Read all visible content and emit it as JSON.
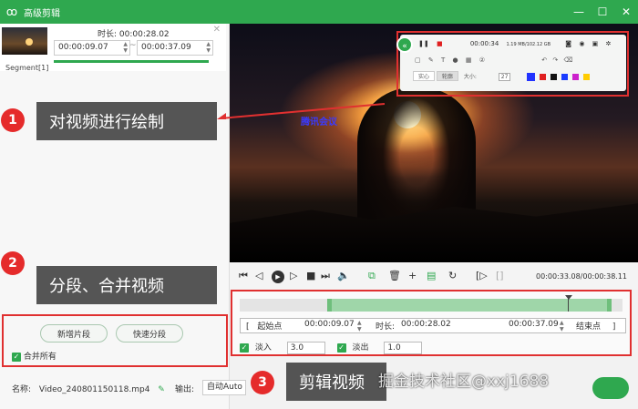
{
  "window": {
    "title": "高级剪辑",
    "minimize": "—",
    "maximize": "☐",
    "close": "✕"
  },
  "segment": {
    "label": "Segment[1]",
    "duration_label": "时长:",
    "duration": "00:00:28.02",
    "start": "00:00:09.07",
    "end": "00:00:37.09",
    "separator": "~"
  },
  "left_buttons": {
    "new_segment": "新增片段",
    "quick_split": "快速分段",
    "merge_all": "合并所有"
  },
  "footer": {
    "name_label": "名称:",
    "file_name": "Video_240801150118.mp4",
    "output_label": "输出:",
    "output_value": "自动Auto"
  },
  "video": {
    "overlay_text": "腾讯会议"
  },
  "recorder": {
    "time": "00:00:34",
    "info": "1.19 MB/102.12 GB",
    "style_a": "实心",
    "style_b": "轮廓",
    "size_label": "大小:",
    "size_value": "27",
    "colors": [
      "#2233ff",
      "#e02020",
      "#111111",
      "#1a3cff",
      "#cc22cc",
      "#ffcc00",
      "#ffffff"
    ]
  },
  "playback": {
    "timecode": "00:00:33.08/00:00:38.11"
  },
  "trim": {
    "start_label": "起始点",
    "start": "00:00:09.07",
    "duration_label": "时长:",
    "duration": "00:00:28.02",
    "end": "00:00:37.09",
    "end_label": "结束点",
    "fade_in_label": "淡入",
    "fade_in": "3.0",
    "fade_out_label": "淡出",
    "fade_out": "1.0"
  },
  "annotations": [
    {
      "num": "1",
      "text": "对视频进行绘制"
    },
    {
      "num": "2",
      "text": "分段、合并视频"
    },
    {
      "num": "3",
      "text": "剪辑视频"
    }
  ],
  "watermark": "掘金技术社区@xxj1688"
}
